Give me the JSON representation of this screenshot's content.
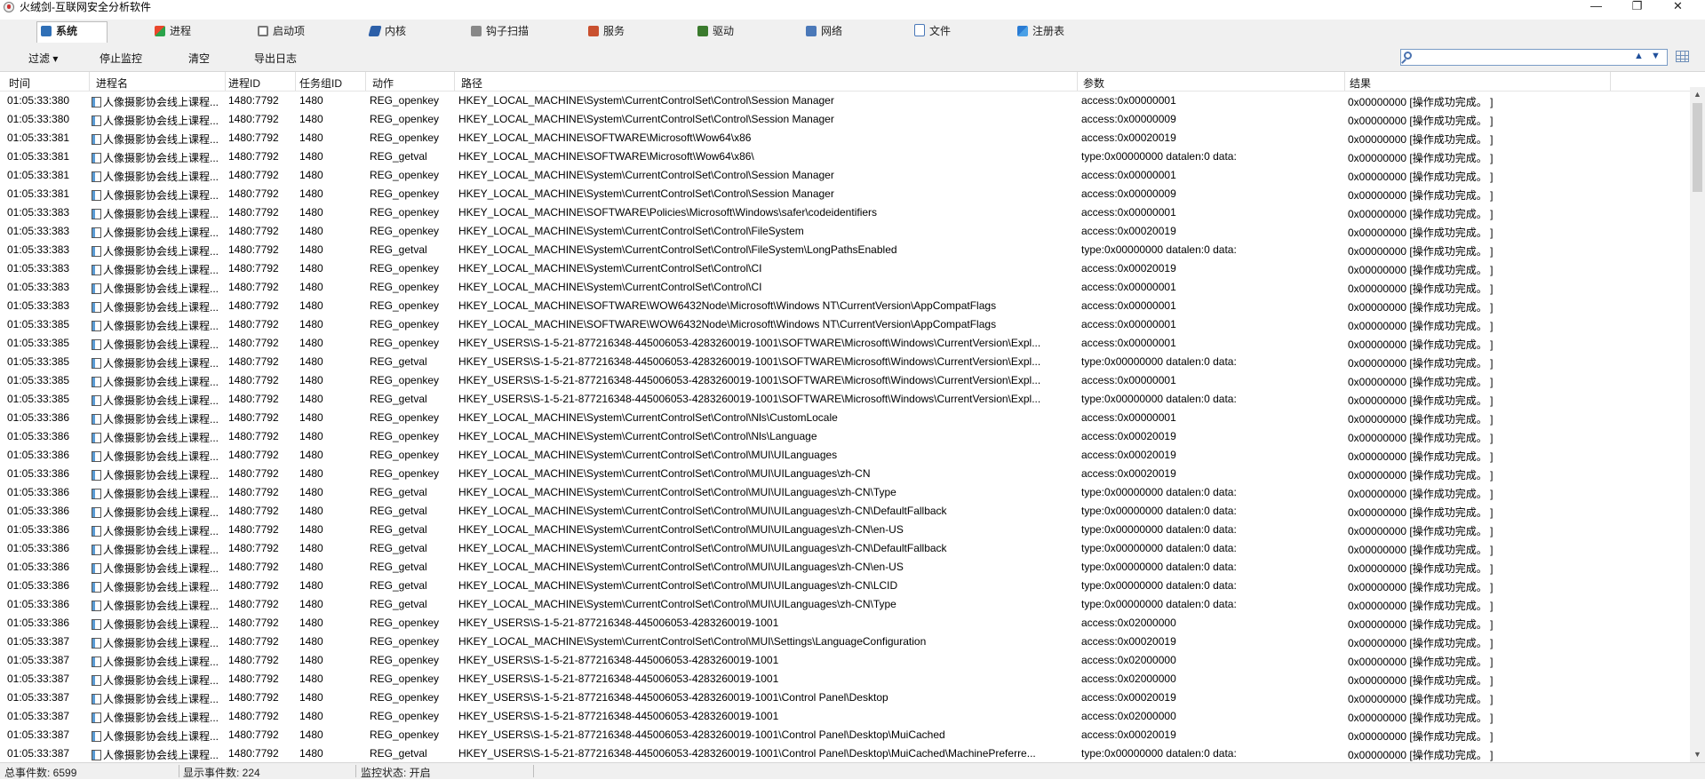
{
  "window": {
    "title": "火绒剑-互联网安全分析软件"
  },
  "tabs": [
    {
      "label": "系统",
      "icon": "system-icon",
      "active": true
    },
    {
      "label": "进程",
      "icon": "process-icon",
      "active": false
    },
    {
      "label": "启动项",
      "icon": "startup-icon",
      "active": false
    },
    {
      "label": "内核",
      "icon": "kernel-icon",
      "active": false
    },
    {
      "label": "钩子扫描",
      "icon": "hook-scan-icon",
      "active": false
    },
    {
      "label": "服务",
      "icon": "service-icon",
      "active": false
    },
    {
      "label": "驱动",
      "icon": "driver-icon",
      "active": false
    },
    {
      "label": "网络",
      "icon": "network-icon",
      "active": false
    },
    {
      "label": "文件",
      "icon": "file-icon",
      "active": false
    },
    {
      "label": "注册表",
      "icon": "registry-icon",
      "active": false
    }
  ],
  "toolbar": {
    "filter": "过滤 ▾",
    "stop_monitor": "停止监控",
    "clear": "清空",
    "export_log": "导出日志",
    "search_value": "",
    "search_placeholder": ""
  },
  "columns": {
    "time": "时间",
    "process_name": "进程名",
    "process_id": "进程ID",
    "task_group_id": "任务组ID",
    "action": "动作",
    "path": "路径",
    "params": "参数",
    "result": "结果"
  },
  "rows": [
    {
      "time": "01:05:33:380",
      "proc": "人像摄影协会线上课程...",
      "pid": "1480:7792",
      "tgid": "1480",
      "action": "REG_openkey",
      "path": "HKEY_LOCAL_MACHINE\\System\\CurrentControlSet\\Control\\Session Manager",
      "params": "access:0x00000001",
      "result": "0x00000000 [操作成功完成。 ]"
    },
    {
      "time": "01:05:33:380",
      "proc": "人像摄影协会线上课程...",
      "pid": "1480:7792",
      "tgid": "1480",
      "action": "REG_openkey",
      "path": "HKEY_LOCAL_MACHINE\\System\\CurrentControlSet\\Control\\Session Manager",
      "params": "access:0x00000009",
      "result": "0x00000000 [操作成功完成。 ]"
    },
    {
      "time": "01:05:33:381",
      "proc": "人像摄影协会线上课程...",
      "pid": "1480:7792",
      "tgid": "1480",
      "action": "REG_openkey",
      "path": "HKEY_LOCAL_MACHINE\\SOFTWARE\\Microsoft\\Wow64\\x86",
      "params": "access:0x00020019",
      "result": "0x00000000 [操作成功完成。 ]"
    },
    {
      "time": "01:05:33:381",
      "proc": "人像摄影协会线上课程...",
      "pid": "1480:7792",
      "tgid": "1480",
      "action": "REG_getval",
      "path": "HKEY_LOCAL_MACHINE\\SOFTWARE\\Microsoft\\Wow64\\x86\\",
      "params": "type:0x00000000 datalen:0 data:",
      "result": "0x00000000 [操作成功完成。 ]"
    },
    {
      "time": "01:05:33:381",
      "proc": "人像摄影协会线上课程...",
      "pid": "1480:7792",
      "tgid": "1480",
      "action": "REG_openkey",
      "path": "HKEY_LOCAL_MACHINE\\System\\CurrentControlSet\\Control\\Session Manager",
      "params": "access:0x00000001",
      "result": "0x00000000 [操作成功完成。 ]"
    },
    {
      "time": "01:05:33:381",
      "proc": "人像摄影协会线上课程...",
      "pid": "1480:7792",
      "tgid": "1480",
      "action": "REG_openkey",
      "path": "HKEY_LOCAL_MACHINE\\System\\CurrentControlSet\\Control\\Session Manager",
      "params": "access:0x00000009",
      "result": "0x00000000 [操作成功完成。 ]"
    },
    {
      "time": "01:05:33:383",
      "proc": "人像摄影协会线上课程...",
      "pid": "1480:7792",
      "tgid": "1480",
      "action": "REG_openkey",
      "path": "HKEY_LOCAL_MACHINE\\SOFTWARE\\Policies\\Microsoft\\Windows\\safer\\codeidentifiers",
      "params": "access:0x00000001",
      "result": "0x00000000 [操作成功完成。 ]"
    },
    {
      "time": "01:05:33:383",
      "proc": "人像摄影协会线上课程...",
      "pid": "1480:7792",
      "tgid": "1480",
      "action": "REG_openkey",
      "path": "HKEY_LOCAL_MACHINE\\System\\CurrentControlSet\\Control\\FileSystem",
      "params": "access:0x00020019",
      "result": "0x00000000 [操作成功完成。 ]"
    },
    {
      "time": "01:05:33:383",
      "proc": "人像摄影协会线上课程...",
      "pid": "1480:7792",
      "tgid": "1480",
      "action": "REG_getval",
      "path": "HKEY_LOCAL_MACHINE\\System\\CurrentControlSet\\Control\\FileSystem\\LongPathsEnabled",
      "params": "type:0x00000000 datalen:0 data:",
      "result": "0x00000000 [操作成功完成。 ]"
    },
    {
      "time": "01:05:33:383",
      "proc": "人像摄影协会线上课程...",
      "pid": "1480:7792",
      "tgid": "1480",
      "action": "REG_openkey",
      "path": "HKEY_LOCAL_MACHINE\\System\\CurrentControlSet\\Control\\CI",
      "params": "access:0x00020019",
      "result": "0x00000000 [操作成功完成。 ]"
    },
    {
      "time": "01:05:33:383",
      "proc": "人像摄影协会线上课程...",
      "pid": "1480:7792",
      "tgid": "1480",
      "action": "REG_openkey",
      "path": "HKEY_LOCAL_MACHINE\\System\\CurrentControlSet\\Control\\CI",
      "params": "access:0x00000001",
      "result": "0x00000000 [操作成功完成。 ]"
    },
    {
      "time": "01:05:33:383",
      "proc": "人像摄影协会线上课程...",
      "pid": "1480:7792",
      "tgid": "1480",
      "action": "REG_openkey",
      "path": "HKEY_LOCAL_MACHINE\\SOFTWARE\\WOW6432Node\\Microsoft\\Windows NT\\CurrentVersion\\AppCompatFlags",
      "params": "access:0x00000001",
      "result": "0x00000000 [操作成功完成。 ]"
    },
    {
      "time": "01:05:33:385",
      "proc": "人像摄影协会线上课程...",
      "pid": "1480:7792",
      "tgid": "1480",
      "action": "REG_openkey",
      "path": "HKEY_LOCAL_MACHINE\\SOFTWARE\\WOW6432Node\\Microsoft\\Windows NT\\CurrentVersion\\AppCompatFlags",
      "params": "access:0x00000001",
      "result": "0x00000000 [操作成功完成。 ]"
    },
    {
      "time": "01:05:33:385",
      "proc": "人像摄影协会线上课程...",
      "pid": "1480:7792",
      "tgid": "1480",
      "action": "REG_openkey",
      "path": "HKEY_USERS\\S-1-5-21-877216348-445006053-4283260019-1001\\SOFTWARE\\Microsoft\\Windows\\CurrentVersion\\Expl...",
      "params": "access:0x00000001",
      "result": "0x00000000 [操作成功完成。 ]"
    },
    {
      "time": "01:05:33:385",
      "proc": "人像摄影协会线上课程...",
      "pid": "1480:7792",
      "tgid": "1480",
      "action": "REG_getval",
      "path": "HKEY_USERS\\S-1-5-21-877216348-445006053-4283260019-1001\\SOFTWARE\\Microsoft\\Windows\\CurrentVersion\\Expl...",
      "params": "type:0x00000000 datalen:0 data:",
      "result": "0x00000000 [操作成功完成。 ]"
    },
    {
      "time": "01:05:33:385",
      "proc": "人像摄影协会线上课程...",
      "pid": "1480:7792",
      "tgid": "1480",
      "action": "REG_openkey",
      "path": "HKEY_USERS\\S-1-5-21-877216348-445006053-4283260019-1001\\SOFTWARE\\Microsoft\\Windows\\CurrentVersion\\Expl...",
      "params": "access:0x00000001",
      "result": "0x00000000 [操作成功完成。 ]"
    },
    {
      "time": "01:05:33:385",
      "proc": "人像摄影协会线上课程...",
      "pid": "1480:7792",
      "tgid": "1480",
      "action": "REG_getval",
      "path": "HKEY_USERS\\S-1-5-21-877216348-445006053-4283260019-1001\\SOFTWARE\\Microsoft\\Windows\\CurrentVersion\\Expl...",
      "params": "type:0x00000000 datalen:0 data:",
      "result": "0x00000000 [操作成功完成。 ]"
    },
    {
      "time": "01:05:33:386",
      "proc": "人像摄影协会线上课程...",
      "pid": "1480:7792",
      "tgid": "1480",
      "action": "REG_openkey",
      "path": "HKEY_LOCAL_MACHINE\\System\\CurrentControlSet\\Control\\Nls\\CustomLocale",
      "params": "access:0x00000001",
      "result": "0x00000000 [操作成功完成。 ]"
    },
    {
      "time": "01:05:33:386",
      "proc": "人像摄影协会线上课程...",
      "pid": "1480:7792",
      "tgid": "1480",
      "action": "REG_openkey",
      "path": "HKEY_LOCAL_MACHINE\\System\\CurrentControlSet\\Control\\Nls\\Language",
      "params": "access:0x00020019",
      "result": "0x00000000 [操作成功完成。 ]"
    },
    {
      "time": "01:05:33:386",
      "proc": "人像摄影协会线上课程...",
      "pid": "1480:7792",
      "tgid": "1480",
      "action": "REG_openkey",
      "path": "HKEY_LOCAL_MACHINE\\System\\CurrentControlSet\\Control\\MUI\\UILanguages",
      "params": "access:0x00020019",
      "result": "0x00000000 [操作成功完成。 ]"
    },
    {
      "time": "01:05:33:386",
      "proc": "人像摄影协会线上课程...",
      "pid": "1480:7792",
      "tgid": "1480",
      "action": "REG_openkey",
      "path": "HKEY_LOCAL_MACHINE\\System\\CurrentControlSet\\Control\\MUI\\UILanguages\\zh-CN",
      "params": "access:0x00020019",
      "result": "0x00000000 [操作成功完成。 ]"
    },
    {
      "time": "01:05:33:386",
      "proc": "人像摄影协会线上课程...",
      "pid": "1480:7792",
      "tgid": "1480",
      "action": "REG_getval",
      "path": "HKEY_LOCAL_MACHINE\\System\\CurrentControlSet\\Control\\MUI\\UILanguages\\zh-CN\\Type",
      "params": "type:0x00000000 datalen:0 data:",
      "result": "0x00000000 [操作成功完成。 ]"
    },
    {
      "time": "01:05:33:386",
      "proc": "人像摄影协会线上课程...",
      "pid": "1480:7792",
      "tgid": "1480",
      "action": "REG_getval",
      "path": "HKEY_LOCAL_MACHINE\\System\\CurrentControlSet\\Control\\MUI\\UILanguages\\zh-CN\\DefaultFallback",
      "params": "type:0x00000000 datalen:0 data:",
      "result": "0x00000000 [操作成功完成。 ]"
    },
    {
      "time": "01:05:33:386",
      "proc": "人像摄影协会线上课程...",
      "pid": "1480:7792",
      "tgid": "1480",
      "action": "REG_getval",
      "path": "HKEY_LOCAL_MACHINE\\System\\CurrentControlSet\\Control\\MUI\\UILanguages\\zh-CN\\en-US",
      "params": "type:0x00000000 datalen:0 data:",
      "result": "0x00000000 [操作成功完成。 ]"
    },
    {
      "time": "01:05:33:386",
      "proc": "人像摄影协会线上课程...",
      "pid": "1480:7792",
      "tgid": "1480",
      "action": "REG_getval",
      "path": "HKEY_LOCAL_MACHINE\\System\\CurrentControlSet\\Control\\MUI\\UILanguages\\zh-CN\\DefaultFallback",
      "params": "type:0x00000000 datalen:0 data:",
      "result": "0x00000000 [操作成功完成。 ]"
    },
    {
      "time": "01:05:33:386",
      "proc": "人像摄影协会线上课程...",
      "pid": "1480:7792",
      "tgid": "1480",
      "action": "REG_getval",
      "path": "HKEY_LOCAL_MACHINE\\System\\CurrentControlSet\\Control\\MUI\\UILanguages\\zh-CN\\en-US",
      "params": "type:0x00000000 datalen:0 data:",
      "result": "0x00000000 [操作成功完成。 ]"
    },
    {
      "time": "01:05:33:386",
      "proc": "人像摄影协会线上课程...",
      "pid": "1480:7792",
      "tgid": "1480",
      "action": "REG_getval",
      "path": "HKEY_LOCAL_MACHINE\\System\\CurrentControlSet\\Control\\MUI\\UILanguages\\zh-CN\\LCID",
      "params": "type:0x00000000 datalen:0 data:",
      "result": "0x00000000 [操作成功完成。 ]"
    },
    {
      "time": "01:05:33:386",
      "proc": "人像摄影协会线上课程...",
      "pid": "1480:7792",
      "tgid": "1480",
      "action": "REG_getval",
      "path": "HKEY_LOCAL_MACHINE\\System\\CurrentControlSet\\Control\\MUI\\UILanguages\\zh-CN\\Type",
      "params": "type:0x00000000 datalen:0 data:",
      "result": "0x00000000 [操作成功完成。 ]"
    },
    {
      "time": "01:05:33:386",
      "proc": "人像摄影协会线上课程...",
      "pid": "1480:7792",
      "tgid": "1480",
      "action": "REG_openkey",
      "path": "HKEY_USERS\\S-1-5-21-877216348-445006053-4283260019-1001",
      "params": "access:0x02000000",
      "result": "0x00000000 [操作成功完成。 ]"
    },
    {
      "time": "01:05:33:387",
      "proc": "人像摄影协会线上课程...",
      "pid": "1480:7792",
      "tgid": "1480",
      "action": "REG_openkey",
      "path": "HKEY_LOCAL_MACHINE\\System\\CurrentControlSet\\Control\\MUI\\Settings\\LanguageConfiguration",
      "params": "access:0x00020019",
      "result": "0x00000000 [操作成功完成。 ]"
    },
    {
      "time": "01:05:33:387",
      "proc": "人像摄影协会线上课程...",
      "pid": "1480:7792",
      "tgid": "1480",
      "action": "REG_openkey",
      "path": "HKEY_USERS\\S-1-5-21-877216348-445006053-4283260019-1001",
      "params": "access:0x02000000",
      "result": "0x00000000 [操作成功完成。 ]"
    },
    {
      "time": "01:05:33:387",
      "proc": "人像摄影协会线上课程...",
      "pid": "1480:7792",
      "tgid": "1480",
      "action": "REG_openkey",
      "path": "HKEY_USERS\\S-1-5-21-877216348-445006053-4283260019-1001",
      "params": "access:0x02000000",
      "result": "0x00000000 [操作成功完成。 ]"
    },
    {
      "time": "01:05:33:387",
      "proc": "人像摄影协会线上课程...",
      "pid": "1480:7792",
      "tgid": "1480",
      "action": "REG_openkey",
      "path": "HKEY_USERS\\S-1-5-21-877216348-445006053-4283260019-1001\\Control Panel\\Desktop",
      "params": "access:0x00020019",
      "result": "0x00000000 [操作成功完成。 ]"
    },
    {
      "time": "01:05:33:387",
      "proc": "人像摄影协会线上课程...",
      "pid": "1480:7792",
      "tgid": "1480",
      "action": "REG_openkey",
      "path": "HKEY_USERS\\S-1-5-21-877216348-445006053-4283260019-1001",
      "params": "access:0x02000000",
      "result": "0x00000000 [操作成功完成。 ]"
    },
    {
      "time": "01:05:33:387",
      "proc": "人像摄影协会线上课程...",
      "pid": "1480:7792",
      "tgid": "1480",
      "action": "REG_openkey",
      "path": "HKEY_USERS\\S-1-5-21-877216348-445006053-4283260019-1001\\Control Panel\\Desktop\\MuiCached",
      "params": "access:0x00020019",
      "result": "0x00000000 [操作成功完成。 ]"
    },
    {
      "time": "01:05:33:387",
      "proc": "人像摄影协会线上课程...",
      "pid": "1480:7792",
      "tgid": "1480",
      "action": "REG_getval",
      "path": "HKEY_USERS\\S-1-5-21-877216348-445006053-4283260019-1001\\Control Panel\\Desktop\\MuiCached\\MachinePreferre...",
      "params": "type:0x00000000 datalen:0 data:",
      "result": "0x00000000 [操作成功完成。 ]"
    }
  ],
  "status": {
    "total": "总事件数: 6599",
    "shown": "显示事件数: 224",
    "monitor": "监控状态: 开启"
  }
}
